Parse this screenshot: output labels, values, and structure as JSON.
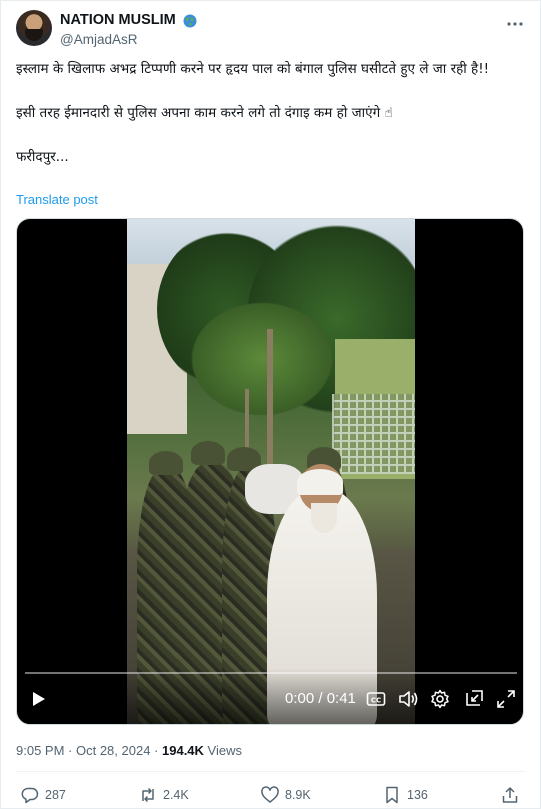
{
  "author": {
    "display_name": "NATION MUSLIM",
    "handle": "@AmjadAsR",
    "badge_icon": "globe-icon"
  },
  "tweet": {
    "line1": "इस्लाम के खिलाफ अभद्र टिप्पणी करने पर हृदय पाल को बंगाल पुलिस घसीटते हुए ले जा रही है!!",
    "line2": "इसी तरह ईमानदारी से पुलिस अपना काम करने लगे तो दंगाइ कम हो जाएंगे ☝",
    "line3": "फरीदपुर...",
    "translate_label": "Translate post"
  },
  "video": {
    "time_display": "0:00 / 0:41",
    "progress": 0.0
  },
  "meta": {
    "time": "9:05 PM",
    "separator": " · ",
    "date": "Oct 28, 2024",
    "views_count": "194.4K",
    "views_label": " Views"
  },
  "actions": {
    "replies": "287",
    "reposts": "2.4K",
    "likes": "8.9K",
    "bookmarks": "136"
  },
  "colors": {
    "link": "#1d9bf0",
    "secondary_text": "#536471",
    "primary_text": "#0f1419"
  }
}
